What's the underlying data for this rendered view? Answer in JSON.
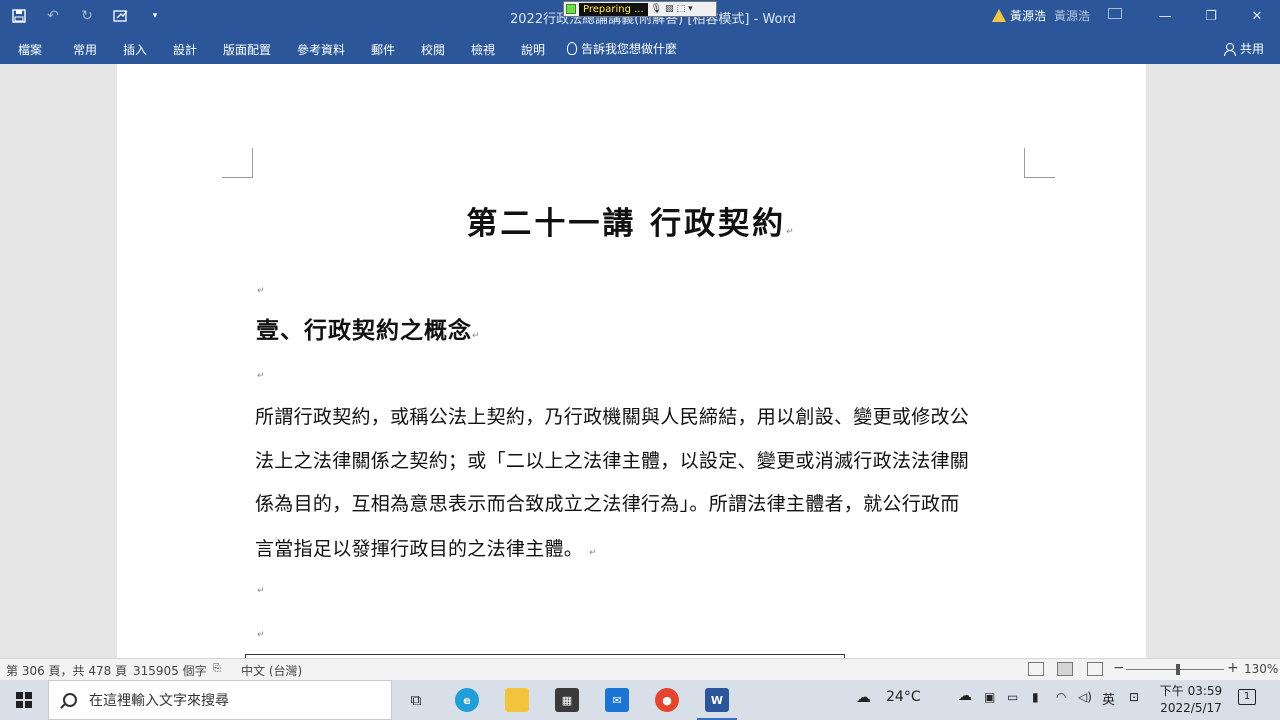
{
  "window": {
    "title": "2022行政法總論講義(附解答) [相容模式]  -  Word",
    "recorder_status": "Preparing ...",
    "user_name": "黃源浩",
    "user_name_secondary": "黃源浩"
  },
  "ribbon": {
    "tabs": [
      "檔案",
      "常用",
      "插入",
      "設計",
      "版面配置",
      "參考資料",
      "郵件",
      "校閱",
      "檢視",
      "說明"
    ],
    "tell_me": "告訴我您想做什麼",
    "share": "共用"
  },
  "document": {
    "title": "第二十一講  行政契約",
    "heading": "壹、行政契約之概念",
    "paragraph_lines": [
      "所謂行政契約，或稱公法上契約，乃行政機關與人民締結，用以創設、變更或修改公",
      "法上之法律關係之契約；或「二以上之法律主體，以設定、變更或消滅行政法法律關",
      "係為目的，互相為意思表示而合致成立之法律行為」。所謂法律主體者，就公行政而",
      "言當指足以發揮行政目的之法律主體。"
    ],
    "paragraph_mark": "↵"
  },
  "status_bar": {
    "page_info": "第 306 頁，共 478 頁",
    "word_count": "315905 個字",
    "language": "中文 (台灣)",
    "zoom": "130%"
  },
  "taskbar": {
    "search_placeholder": "在這裡輸入文字來搜尋",
    "temperature": "24°C",
    "ime": "英",
    "time": "下午 03:59",
    "date": "2022/5/17",
    "notification_count": "1"
  }
}
